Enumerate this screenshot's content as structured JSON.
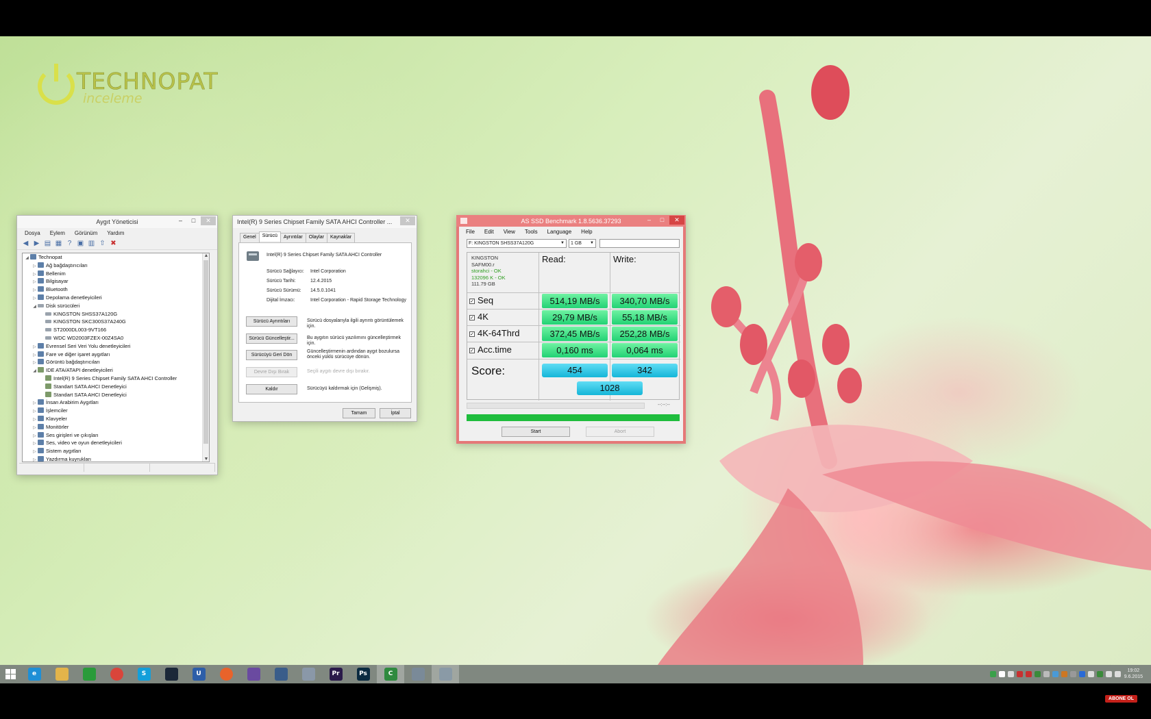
{
  "logo": {
    "brand": "TECHNOPAT",
    "subtitle": "inceleme"
  },
  "device_manager": {
    "title": "Aygıt Yöneticisi",
    "menu": [
      "Dosya",
      "Eylem",
      "Görünüm",
      "Yardım"
    ],
    "toolbar_icons": [
      "back-icon",
      "forward-icon",
      "show-hide-tree-icon",
      "properties-icon",
      "help-icon",
      "device-view-icon",
      "scan-hardware-icon",
      "update-driver-icon",
      "uninstall-icon"
    ],
    "tree": [
      {
        "label": "Technopat",
        "level": 0,
        "expanded": true,
        "icon": "computer"
      },
      {
        "label": "Ağ bağdaştırıcıları",
        "level": 1,
        "expanded": false,
        "icon": "network"
      },
      {
        "label": "Bellenim",
        "level": 1,
        "expanded": false,
        "icon": "firmware"
      },
      {
        "label": "Bilgisayar",
        "level": 1,
        "expanded": false,
        "icon": "computer"
      },
      {
        "label": "Bluetooth",
        "level": 1,
        "expanded": false,
        "icon": "bluetooth"
      },
      {
        "label": "Depolama denetleyicileri",
        "level": 1,
        "expanded": false,
        "icon": "storage"
      },
      {
        "label": "Disk sürücüleri",
        "level": 1,
        "expanded": true,
        "icon": "disk"
      },
      {
        "label": "KINGSTON SHSS37A120G",
        "level": 2,
        "icon": "disk"
      },
      {
        "label": "KINGSTON SKC300S37A240G",
        "level": 2,
        "icon": "disk"
      },
      {
        "label": "ST2000DL003-9VT166",
        "level": 2,
        "icon": "disk"
      },
      {
        "label": "WDC WD2003FZEX-00Z4SA0",
        "level": 2,
        "icon": "disk"
      },
      {
        "label": "Evrensel Seri Veri Yolu denetleyicileri",
        "level": 1,
        "expanded": false,
        "icon": "usb"
      },
      {
        "label": "Fare ve diğer işaret aygıtları",
        "level": 1,
        "expanded": false,
        "icon": "mouse"
      },
      {
        "label": "Görüntü bağdaştırıcıları",
        "level": 1,
        "expanded": false,
        "icon": "display"
      },
      {
        "label": "IDE ATA/ATAPI denetleyicileri",
        "level": 1,
        "expanded": true,
        "icon": "controller"
      },
      {
        "label": "Intel(R) 9 Series Chipset Family SATA AHCI Controller",
        "level": 2,
        "icon": "controller"
      },
      {
        "label": "Standart SATA AHCI Denetleyici",
        "level": 2,
        "icon": "controller"
      },
      {
        "label": "Standart SATA AHCI Denetleyici",
        "level": 2,
        "icon": "controller"
      },
      {
        "label": "İnsan Arabirim Aygıtları",
        "level": 1,
        "expanded": false,
        "icon": "hid"
      },
      {
        "label": "İşlemciler",
        "level": 1,
        "expanded": false,
        "icon": "cpu"
      },
      {
        "label": "Klavyeler",
        "level": 1,
        "expanded": false,
        "icon": "keyboard"
      },
      {
        "label": "Monitörler",
        "level": 1,
        "expanded": false,
        "icon": "monitor"
      },
      {
        "label": "Ses girişleri ve çıkışları",
        "level": 1,
        "expanded": false,
        "icon": "audio"
      },
      {
        "label": "Ses, video ve oyun denetleyicileri",
        "level": 1,
        "expanded": false,
        "icon": "audio"
      },
      {
        "label": "Sistem aygıtları",
        "level": 1,
        "expanded": false,
        "icon": "system"
      },
      {
        "label": "Yazdırma kuyrukları",
        "level": 1,
        "expanded": false,
        "icon": "printer"
      }
    ]
  },
  "driver_props": {
    "title": "Intel(R) 9 Series Chipset Family SATA AHCI Controller ...",
    "tabs": [
      "Genel",
      "Sürücü",
      "Ayrıntılar",
      "Olaylar",
      "Kaynaklar"
    ],
    "active_tab": "Sürücü",
    "device_name": "Intel(R) 9 Series Chipset Family SATA AHCI Controller",
    "fields": [
      {
        "label": "Sürücü Sağlayıcı:",
        "value": "Intel Corporation"
      },
      {
        "label": "Sürücü Tarihi:",
        "value": "12.4.2015"
      },
      {
        "label": "Sürücü Sürümü:",
        "value": "14.5.0.1041"
      },
      {
        "label": "Dijital İmzacı:",
        "value": "Intel Corporation - Rapid Storage Technology"
      }
    ],
    "actions": [
      {
        "button": "Sürücü Ayrıntıları",
        "desc": "Sürücü dosyalarıyla ilgili ayrıntı görüntülemek için.",
        "enabled": true
      },
      {
        "button": "Sürücü Güncelleştir...",
        "desc": "Bu aygıtın sürücü yazılımını güncelleştirmek için.",
        "enabled": true
      },
      {
        "button": "Sürücüyü Geri Dön",
        "desc": "Güncelleştirmenin ardından aygıt bozulursa önceki yüklü sürücüye dönün.",
        "enabled": true
      },
      {
        "button": "Devre Dışı Bırak",
        "desc": "Seçili aygıtı devre dışı bırakır.",
        "enabled": false
      },
      {
        "button": "Kaldır",
        "desc": "Sürücüyü kaldırmak için (Gelişmiş).",
        "enabled": true
      }
    ],
    "ok_label": "Tamam",
    "cancel_label": "İptal"
  },
  "as_ssd": {
    "title": "AS SSD Benchmark 1.8.5636.37293",
    "menu": [
      "File",
      "Edit",
      "View",
      "Tools",
      "Language",
      "Help"
    ],
    "drive_select": "F: KINGSTON SHSS37A120G",
    "size_select": "1 GB",
    "drive_info": {
      "vendor": "KINGSTON",
      "firmware": "SAFM00.r",
      "driver": "storahci - OK",
      "alignment": "132096 K - OK",
      "capacity": "111.79 GB"
    },
    "read_header": "Read:",
    "write_header": "Write:",
    "tests": [
      {
        "name": "Seq",
        "checked": true,
        "read": "514,19 MB/s",
        "write": "340,70 MB/s"
      },
      {
        "name": "4K",
        "checked": true,
        "read": "29,79 MB/s",
        "write": "55,18 MB/s"
      },
      {
        "name": "4K-64Thrd",
        "checked": true,
        "read": "372,45 MB/s",
        "write": "252,28 MB/s"
      },
      {
        "name": "Acc.time",
        "checked": true,
        "read": "0,160 ms",
        "write": "0,064 ms"
      }
    ],
    "score_label": "Score:",
    "score_read": "454",
    "score_write": "342",
    "score_total": "1028",
    "time_readout": "--:--:--",
    "progress": 1.0,
    "start_label": "Start",
    "abort_label": "Abort"
  },
  "taskbar": {
    "apps": [
      {
        "name": "internet-explorer-icon",
        "glyph": "e",
        "color": "#1e8fd6",
        "active": false
      },
      {
        "name": "file-explorer-icon",
        "glyph": "",
        "color": "#e3b44a",
        "active": false
      },
      {
        "name": "store-icon",
        "glyph": "",
        "color": "#2a9b3a",
        "active": false
      },
      {
        "name": "chrome-icon",
        "glyph": "",
        "color": "#d9453b",
        "active": false
      },
      {
        "name": "skype-icon",
        "glyph": "S",
        "color": "#139fda",
        "active": false
      },
      {
        "name": "steam-icon",
        "glyph": "",
        "color": "#1b2838",
        "active": false
      },
      {
        "name": "uplay-icon",
        "glyph": "U",
        "color": "#2d5ea8",
        "active": false
      },
      {
        "name": "origin-icon",
        "glyph": "",
        "color": "#e8632b",
        "active": false
      },
      {
        "name": "cpu-z-icon",
        "glyph": "",
        "color": "#6a4aa0",
        "active": false
      },
      {
        "name": "hwinfo-icon",
        "glyph": "",
        "color": "#3a5d8a",
        "active": false
      },
      {
        "name": "dynamic-icon",
        "glyph": "",
        "color": "#8a98a8",
        "active": false
      },
      {
        "name": "premiere-icon",
        "glyph": "Pr",
        "color": "#2a1a4a",
        "active": false
      },
      {
        "name": "photoshop-icon",
        "glyph": "Ps",
        "color": "#0a2a40",
        "active": false
      },
      {
        "name": "camtasia-icon",
        "glyph": "C",
        "color": "#2f8a3f",
        "active": true
      },
      {
        "name": "device-manager-icon",
        "glyph": "",
        "color": "#7a8a98",
        "active": false
      },
      {
        "name": "as-ssd-icon",
        "glyph": "",
        "color": "#8a9aa6",
        "active": true
      }
    ],
    "tray_colors": [
      "#3aa04a",
      "#ffffff",
      "#dddddd",
      "#c83030",
      "#c83030",
      "#3a8a3a",
      "#bbbbbb",
      "#4a9ad6",
      "#cc7722",
      "#999999",
      "#2a6ad6",
      "#dddddd",
      "#3a8a3a",
      "#dddddd",
      "#dddddd"
    ],
    "clock_time": "19:02",
    "clock_date": "9.6.2015"
  },
  "overlay": {
    "subscribe_label": "ABONE OL"
  }
}
